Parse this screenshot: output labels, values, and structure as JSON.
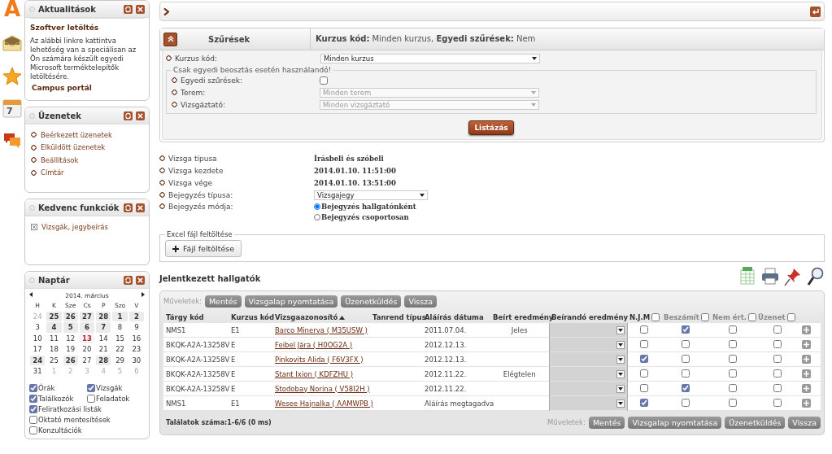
{
  "side_icons": [
    {
      "kind": "logo",
      "label": "A"
    },
    {
      "kind": "mail"
    },
    {
      "kind": "star"
    },
    {
      "kind": "calendar",
      "label": "7"
    },
    {
      "kind": "chat"
    }
  ],
  "news": {
    "title": "Aktualitások",
    "heading": "Szoftver letöltés",
    "text": "Az alábbi linkre kattintva lehetőség van a speciálisan az Ön számára készült egyedi Microsoft terméktelepítők letöltésére.",
    "link": "Campus portál"
  },
  "messages": {
    "title": "Üzenetek",
    "items": [
      "Beérkezett üzenetek",
      "Elküldött üzenetek",
      "Beállítások",
      "Címtár"
    ]
  },
  "favorites": {
    "title": "Kedvenc funkciók",
    "items": [
      "Vizsgák, jegybeírás"
    ]
  },
  "calendar": {
    "title": "Naptár",
    "month": "2014. március",
    "weekdays": [
      "H",
      "K",
      "Sze",
      "Cs",
      "P",
      "Szo",
      "V"
    ],
    "days": [
      {
        "d": "24",
        "kind": "other"
      },
      {
        "d": "25",
        "kind": "event"
      },
      {
        "d": "26",
        "kind": "event"
      },
      {
        "d": "27",
        "kind": "event"
      },
      {
        "d": "28",
        "kind": "event"
      },
      {
        "d": "1",
        "kind": "event"
      },
      {
        "d": "2",
        "kind": "event"
      },
      {
        "d": "3",
        "kind": "plain"
      },
      {
        "d": "4",
        "kind": "event"
      },
      {
        "d": "5",
        "kind": "event"
      },
      {
        "d": "6",
        "kind": "event"
      },
      {
        "d": "7",
        "kind": "event"
      },
      {
        "d": "8",
        "kind": "plain"
      },
      {
        "d": "9",
        "kind": "plain"
      },
      {
        "d": "10",
        "kind": "plain"
      },
      {
        "d": "11",
        "kind": "plain"
      },
      {
        "d": "12",
        "kind": "plain"
      },
      {
        "d": "13",
        "kind": "today"
      },
      {
        "d": "14",
        "kind": "plain"
      },
      {
        "d": "15",
        "kind": "plain"
      },
      {
        "d": "16",
        "kind": "plain"
      },
      {
        "d": "17",
        "kind": "plain"
      },
      {
        "d": "18",
        "kind": "plain"
      },
      {
        "d": "19",
        "kind": "plain"
      },
      {
        "d": "20",
        "kind": "plain"
      },
      {
        "d": "21",
        "kind": "plain"
      },
      {
        "d": "22",
        "kind": "plain"
      },
      {
        "d": "23",
        "kind": "plain"
      },
      {
        "d": "24",
        "kind": "event"
      },
      {
        "d": "25",
        "kind": "plain"
      },
      {
        "d": "26",
        "kind": "event"
      },
      {
        "d": "27",
        "kind": "plain"
      },
      {
        "d": "28",
        "kind": "event"
      },
      {
        "d": "29",
        "kind": "plain"
      },
      {
        "d": "30",
        "kind": "plain"
      },
      {
        "d": "31",
        "kind": "plain"
      },
      {
        "d": "1",
        "kind": "other"
      },
      {
        "d": "2",
        "kind": "other"
      },
      {
        "d": "3",
        "kind": "other"
      },
      {
        "d": "4",
        "kind": "other"
      },
      {
        "d": "5",
        "kind": "other"
      },
      {
        "d": "6",
        "kind": "other"
      }
    ],
    "filters": [
      {
        "label": "Órák",
        "checked": true
      },
      {
        "label": "Vizsgák",
        "checked": true
      },
      {
        "label": "Találkozók",
        "checked": true
      },
      {
        "label": "Feladatok",
        "checked": false
      },
      {
        "label": "Feliratkozási listák",
        "checked": true
      },
      {
        "label": "Oktató mentesítések",
        "checked": false
      },
      {
        "label": "Konzultációk",
        "checked": false
      }
    ]
  },
  "filter_panel": {
    "title": "Szűrések",
    "summary": "**Kurzus kód:** Minden kurzus, **Egyedi szűrések:** Nem",
    "course_label": "Kurzus kód:",
    "course_value": "Minden kurzus",
    "group_legend": "Csak egyedi beosztás esetén használandó!",
    "custom_label": "Egyedi szűrések:",
    "custom_checked": false,
    "room_label": "Terem:",
    "room_value": "Minden terem",
    "room_disabled": true,
    "examiner_label": "Vizsgáztató:",
    "examiner_value": "Minden vizsgáztató",
    "examiner_disabled": true,
    "list_button": "Listázás"
  },
  "exam_info": [
    {
      "label": "Vizsga típusa",
      "value": "Írásbeli és szóbeli"
    },
    {
      "label": "Vizsga kezdete",
      "value": "2014.01.10. 11:51:00"
    },
    {
      "label": "Vizsga vége",
      "value": "2014.01.10. 13:51:00"
    }
  ],
  "entry_type": {
    "label": "Bejegyzés típusa:",
    "value": "Vizsgajegy"
  },
  "entry_mode": {
    "label": "Bejegyzés módja:",
    "options": [
      {
        "label": "Bejegyzés hallgatónként",
        "selected": true
      },
      {
        "label": "Bejegyzés csoportosan",
        "selected": false
      }
    ]
  },
  "excel": {
    "legend": "Excel fájl feltöltése",
    "button": "Fájl feltöltése"
  },
  "students": {
    "title": "Jelentkezett hallgatók",
    "top_actions": {
      "label": "Műveletek:",
      "buttons": [
        "Mentés",
        "Vizsgalap nyomtatása",
        "Üzenetküldés",
        "Vissza"
      ]
    },
    "bottom_actions": {
      "label": "Műveletek:",
      "buttons": [
        "Mentés",
        "Vizsgalap nyomtatása",
        "Üzenetküldés",
        "Vissza"
      ]
    },
    "columns": [
      {
        "label": "Tárgy kód"
      },
      {
        "label": "Kurzus kód"
      },
      {
        "label": "Vizsgaazonosító",
        "sorted": true
      },
      {
        "label": "Tanrend típus"
      },
      {
        "label": "Aláírás dátuma"
      },
      {
        "label": "Beírt eredmény"
      },
      {
        "label": "Beírandó eredmény"
      },
      {
        "label": "N.J.M",
        "checked": false
      },
      {
        "label": "Beszámít",
        "checked": false
      },
      {
        "label": "Nem ért.",
        "checked": false
      },
      {
        "label": "Üzenet",
        "checked": false
      }
    ],
    "rows": [
      {
        "subject": "NMS1",
        "course": "E1",
        "student": "Barco Minerva ( M35USW )",
        "signature": "2011.07.04.",
        "result": "Jeles",
        "njm": false,
        "credit": true,
        "not_eval": false,
        "message": false
      },
      {
        "subject": "BKQK-A2A-13258V",
        "course": "E",
        "student": "Feibel Jára ( H0OG2A )",
        "signature": "2012.12.13.",
        "njm": false,
        "credit": false,
        "not_eval": false,
        "message": false
      },
      {
        "subject": "BKQK-A2A-13258V",
        "course": "E",
        "student": "Pinkovits Alida ( F6V3FX )",
        "signature": "2012.12.13.",
        "njm": true,
        "credit": false,
        "not_eval": false,
        "message": false
      },
      {
        "subject": "BKQK-A2A-13258V",
        "course": "E",
        "student": "Stant Ixion ( KDFZHU )",
        "signature": "2012.11.22.",
        "result": "Elégtelen",
        "njm": false,
        "credit": false,
        "not_eval": false,
        "message": false
      },
      {
        "subject": "BKQK-A2A-13258V",
        "course": "E",
        "student": "Stodobay Norina ( V58I2H )",
        "signature": "2012.11.22.",
        "njm": false,
        "credit": true,
        "not_eval": false,
        "message": false
      },
      {
        "subject": "NMS1",
        "course": "E1",
        "student": "Wesee Hajnalka ( AAMWPB )",
        "signature": "Aláírás megtagadva",
        "njm": true,
        "credit": false,
        "not_eval": false,
        "message": false
      }
    ],
    "footer_count": "Találatok száma:1-6/6 (0 ms)"
  }
}
